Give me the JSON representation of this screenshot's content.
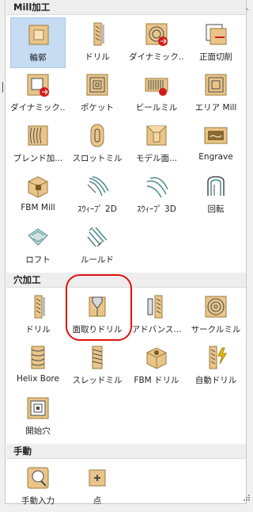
{
  "sections": [
    {
      "title": "Mill加工",
      "items": [
        {
          "label": "輪郭",
          "icon": "contour-icon",
          "selected": true
        },
        {
          "label": "ドリル",
          "icon": "drill-icon"
        },
        {
          "label": "ダイナミック...",
          "icon": "dynamic-mill-icon"
        },
        {
          "label": "正面切削",
          "icon": "face-icon"
        },
        {
          "label": "ダイナミック...",
          "icon": "dynamic-contour-icon"
        },
        {
          "label": "ポケット",
          "icon": "pocket-icon"
        },
        {
          "label": "ビールミル",
          "icon": "peel-mill-icon"
        },
        {
          "label": "エリア Mill",
          "icon": "area-mill-icon"
        },
        {
          "label": "ブレンド加...",
          "icon": "blend-icon"
        },
        {
          "label": "スロットミル",
          "icon": "slot-mill-icon"
        },
        {
          "label": "モデル面...",
          "icon": "model-chamfer-icon"
        },
        {
          "label": "Engrave",
          "icon": "engrave-icon"
        },
        {
          "label": "FBM Mill",
          "icon": "fbm-mill-icon"
        },
        {
          "label": "ｽｳｨｰﾌﾟ 2D",
          "icon": "sweep-2d-icon"
        },
        {
          "label": "ｽｳｨｰﾌﾟ 3D",
          "icon": "sweep-3d-icon"
        },
        {
          "label": "回転",
          "icon": "revolve-icon"
        },
        {
          "label": "ロフト",
          "icon": "loft-icon"
        },
        {
          "label": "ルールド",
          "icon": "ruled-icon"
        }
      ]
    },
    {
      "title": "穴加工",
      "items": [
        {
          "label": "ドリル",
          "icon": "hole-drill-icon"
        },
        {
          "label": "面取りドリル",
          "icon": "chamfer-drill-icon"
        },
        {
          "label": "アドバンス...",
          "icon": "advanced-drill-icon"
        },
        {
          "label": "サークルミル",
          "icon": "circle-mill-icon"
        },
        {
          "label": "Helix Bore",
          "icon": "helix-bore-icon"
        },
        {
          "label": "スレッドミル",
          "icon": "thread-mill-icon"
        },
        {
          "label": "FBM ドリル",
          "icon": "fbm-drill-icon"
        },
        {
          "label": "自動ドリル",
          "icon": "auto-drill-icon"
        },
        {
          "label": "開始穴",
          "icon": "start-hole-icon"
        }
      ]
    },
    {
      "title": "手動",
      "items": [
        {
          "label": "手動入力",
          "icon": "manual-entry-icon"
        },
        {
          "label": "点",
          "icon": "point-icon"
        }
      ]
    }
  ],
  "colors": {
    "accent": "#c5dcf3",
    "highlight": "#e01010",
    "stock": "#e9c58a",
    "stock_edge": "#9c7a3c"
  }
}
